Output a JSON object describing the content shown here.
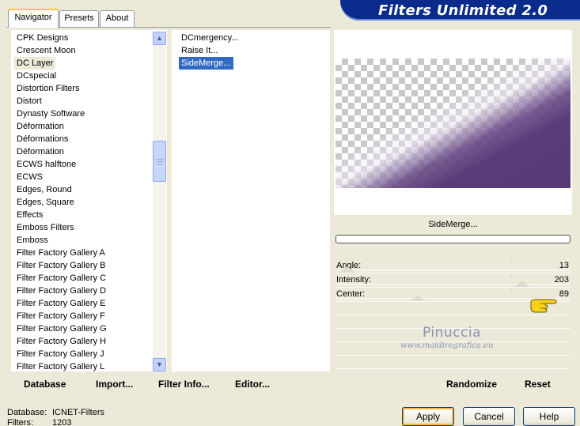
{
  "tabs": [
    {
      "label": "Navigator",
      "active": true
    },
    {
      "label": "Presets",
      "active": false
    },
    {
      "label": "About",
      "active": false
    }
  ],
  "title": "Filters Unlimited 2.0",
  "categories": [
    "CPK Designs",
    "Crescent Moon",
    "DC Layer",
    "DCspecial",
    "Distortion Filters",
    "Distort",
    "Dynasty Software",
    "Déformation",
    "Déformations",
    "Déformation",
    "ECWS halftone",
    "ECWS",
    "Edges, Round",
    "Edges, Square",
    "Effects",
    "Emboss Filters",
    "Emboss",
    "Filter Factory Gallery A",
    "Filter Factory Gallery B",
    "Filter Factory Gallery C",
    "Filter Factory Gallery D",
    "Filter Factory Gallery E",
    "Filter Factory Gallery F",
    "Filter Factory Gallery G",
    "Filter Factory Gallery H",
    "Filter Factory Gallery J",
    "Filter Factory Gallery L"
  ],
  "selected_category": "DC Layer",
  "filters": [
    "DCmergency...",
    "Raise It...",
    "SideMerge..."
  ],
  "selected_filter": "SideMerge...",
  "toolbar": {
    "database": "Database",
    "import": "Import...",
    "filter_info": "Filter Info...",
    "editor": "Editor...",
    "randomize": "Randomize",
    "reset": "Reset"
  },
  "preview": {
    "filter_name": "SideMerge...",
    "colors": {
      "purple": "#5a3d78",
      "checker": "#c8c8c8"
    }
  },
  "sliders": [
    {
      "label": "Angle:",
      "value": "13",
      "fraction": 0.051
    },
    {
      "label": "Intensity:",
      "value": "203",
      "fraction": 0.796
    },
    {
      "label": "Center:",
      "value": "89",
      "fraction": 0.349
    }
  ],
  "watermark": {
    "name": "Pinuccia",
    "url": "www.maidiregrafica.eu"
  },
  "status": {
    "database_label": "Database:",
    "database_value": "ICNET-Filters",
    "filters_label": "Filters:",
    "filters_value": "1203"
  },
  "buttons": {
    "apply": "Apply",
    "cancel": "Cancel",
    "help": "Help"
  },
  "icons": {
    "pointer": "pointing-hand-icon",
    "scroll_up": "arrow-up-icon",
    "scroll_down": "arrow-down-icon"
  }
}
